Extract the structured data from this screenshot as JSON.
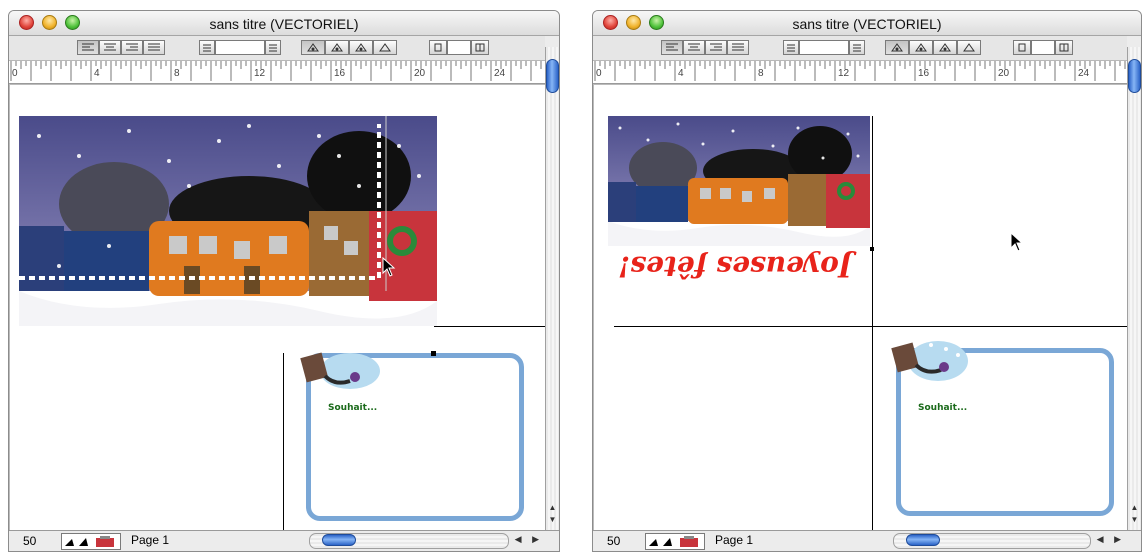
{
  "windows": [
    {
      "title": "sans titre (VECTORIEL)",
      "zoom": "50",
      "page_label": "Page 1",
      "ruler_marks": [
        "0",
        "4",
        "8",
        "12",
        "16",
        "20",
        "24"
      ],
      "souhait_text": "Souhait..."
    },
    {
      "title": "sans titre (VECTORIEL)",
      "zoom": "50",
      "page_label": "Page 1",
      "ruler_marks": [
        "0",
        "4",
        "8",
        "12",
        "16",
        "20",
        "24"
      ],
      "banner_text": "Joyeuses fêtes!",
      "souhait_text": "Souhait..."
    }
  ],
  "colors": {
    "banner_red": "#e8231a",
    "card_frame_blue": "#7aa7d6",
    "scroll_thumb_blue": "#2c64c8"
  },
  "icons": [
    "close-icon",
    "minimize-icon",
    "zoom-icon",
    "align-left-icon",
    "align-center-icon",
    "align-right-icon",
    "justify-icon",
    "text-field-icon",
    "layer-icon",
    "view-icon",
    "arrow-cursor-icon",
    "line-tool-icon",
    "fill-tool-icon",
    "toolbox-icon"
  ]
}
